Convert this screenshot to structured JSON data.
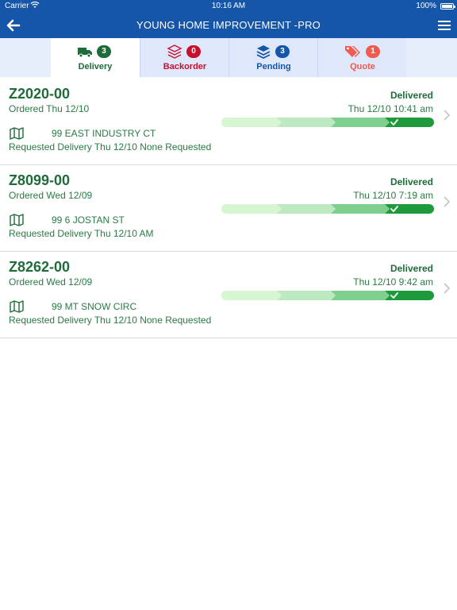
{
  "status_bar": {
    "carrier": "Carrier",
    "time": "10:16 AM",
    "battery": "100%",
    "wifi_icon": "wifi-icon"
  },
  "nav": {
    "title": "YOUNG HOME IMPROVEMENT -PRO",
    "back_icon": "back-arrow-icon",
    "menu_icon": "hamburger-menu-icon"
  },
  "tabs": [
    {
      "label": "Delivery",
      "count": "3",
      "icon": "truck-icon",
      "color": "#1f6b3a",
      "badge_color": "#1f6b3a",
      "active": true
    },
    {
      "label": "Backorder",
      "count": "0",
      "icon": "layers-icon",
      "color": "#c8102e",
      "badge_color": "#c8102e",
      "active": false
    },
    {
      "label": "Pending",
      "count": "3",
      "icon": "stack-icon",
      "color": "#1556a8",
      "badge_color": "#1556a8",
      "active": false
    },
    {
      "label": "Quote",
      "count": "1",
      "icon": "tags-icon",
      "color": "#f05a4f",
      "badge_color": "#f05a4f",
      "active": false
    }
  ],
  "orders": [
    {
      "number": "Z2020-00",
      "ordered": "Ordered Thu 12/10",
      "status": "Delivered",
      "time": "Thu 12/10 10:41 am",
      "address": "99 EAST INDUSTRY CT",
      "requested": "Requested Delivery Thu 12/10 None Requested",
      "progress_steps_complete": 4,
      "progress_steps_total": 4
    },
    {
      "number": "Z8099-00",
      "ordered": "Ordered Wed 12/09",
      "status": "Delivered",
      "time": "Thu 12/10 7:19 am",
      "address": "99 6 JOSTAN ST",
      "requested": "Requested Delivery Thu 12/10 AM",
      "progress_steps_complete": 4,
      "progress_steps_total": 4
    },
    {
      "number": "Z8262-00",
      "ordered": "Ordered Wed 12/09",
      "status": "Delivered",
      "time": "Thu 12/10 9:42 am",
      "address": "99 MT SNOW CIRC",
      "requested": "Requested Delivery Thu 12/10 None Requested",
      "progress_steps_complete": 4,
      "progress_steps_total": 4
    }
  ],
  "colors": {
    "brand_blue": "#1556a8",
    "delivered_green": "#1f6b3a",
    "progress_light": "#d3f5cf",
    "progress_dark": "#1e9a3c"
  }
}
